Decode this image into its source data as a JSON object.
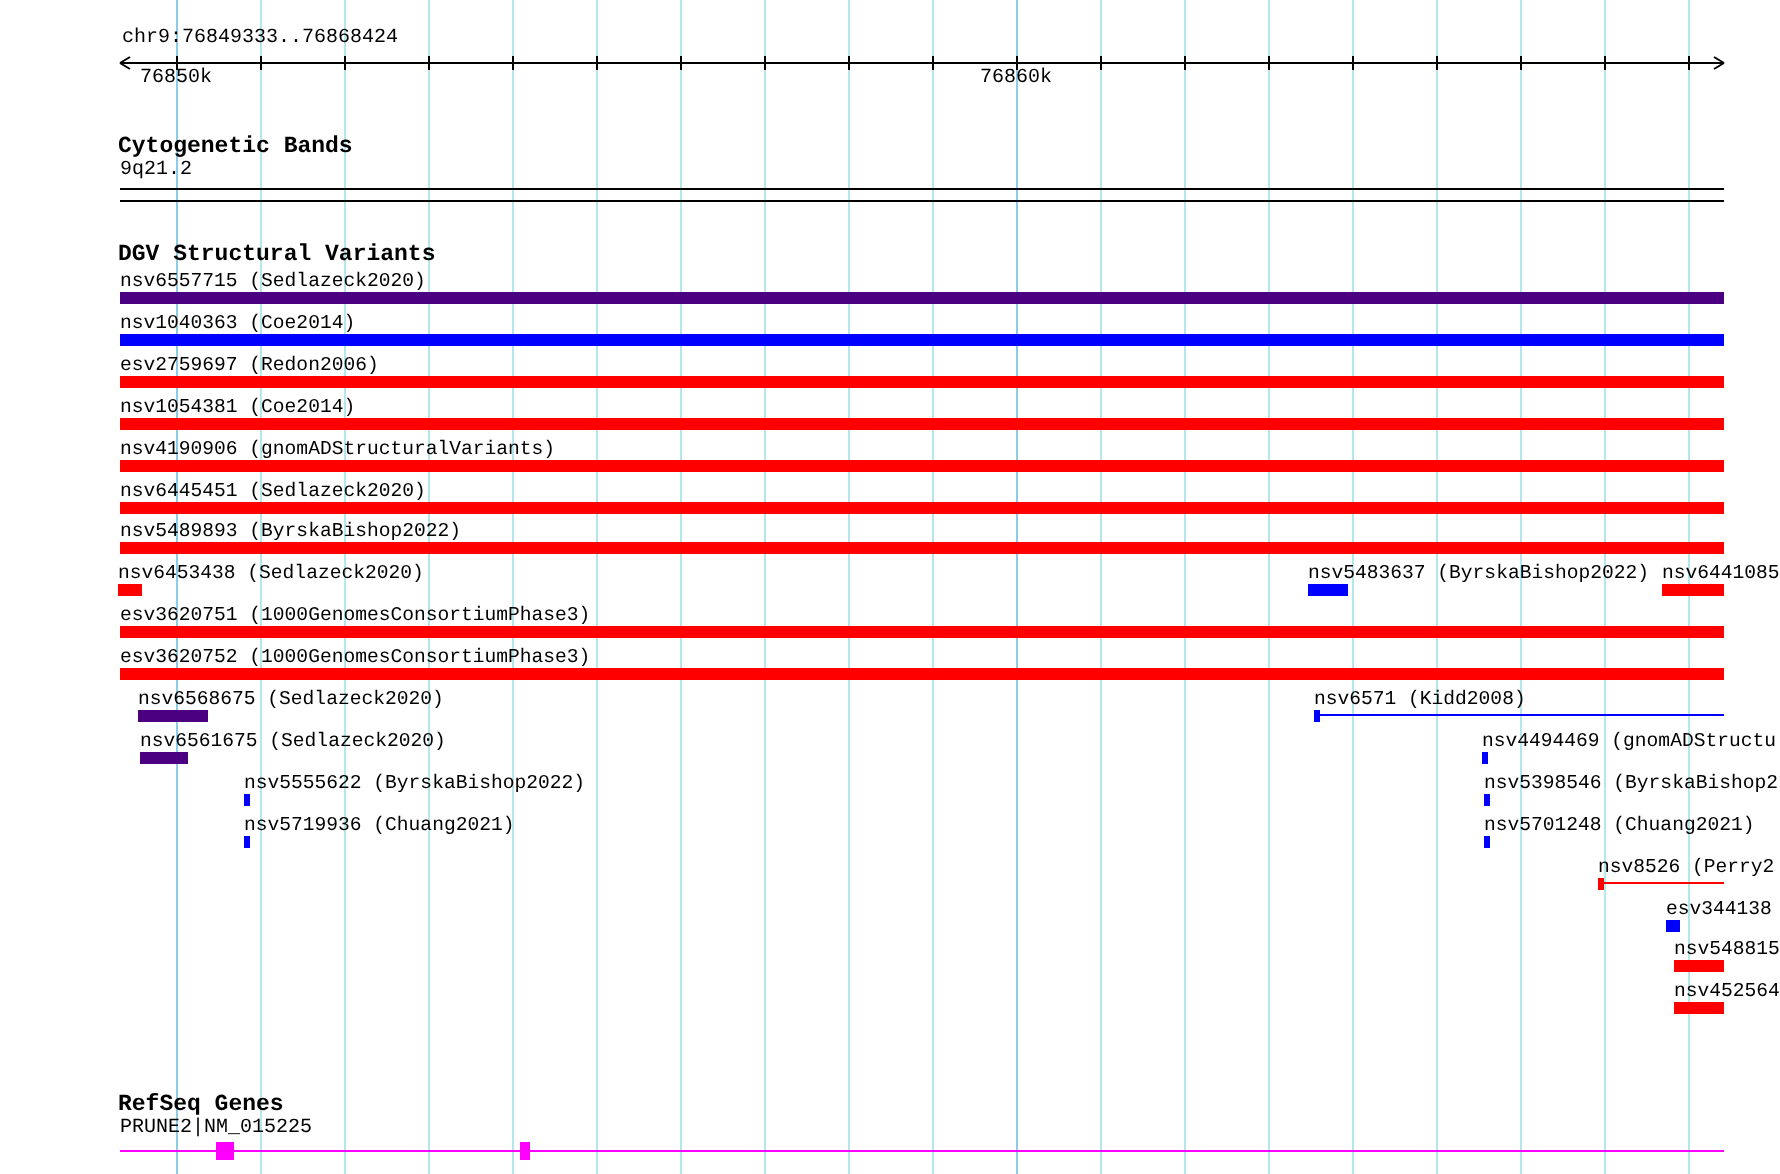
{
  "region": {
    "label": "chr9:76849333..76868424"
  },
  "ruler": {
    "ticks": [
      {
        "label": "76850k"
      },
      {
        "label": "76860k"
      }
    ]
  },
  "tracks": [
    {
      "kind": "bands",
      "title": "Cytogenetic Bands",
      "bands": [
        {
          "label": "9q21.2"
        }
      ]
    },
    {
      "kind": "variants",
      "title": "DGV Structural Variants",
      "rows": [
        [
          {
            "label": "nsv6557715 (Sedlazeck2020)",
            "color": "#4b0082",
            "kind": "block"
          }
        ],
        [
          {
            "label": "nsv1040363 (Coe2014)",
            "color": "#0000ff",
            "kind": "block"
          }
        ],
        [
          {
            "label": "esv2759697 (Redon2006)",
            "color": "#ff0000",
            "kind": "block"
          }
        ],
        [
          {
            "label": "nsv1054381 (Coe2014)",
            "color": "#ff0000",
            "kind": "block"
          }
        ],
        [
          {
            "label": "nsv4190906 (gnomADStructuralVariants)",
            "color": "#ff0000",
            "kind": "block"
          }
        ],
        [
          {
            "label": "nsv6445451 (Sedlazeck2020)",
            "color": "#ff0000",
            "kind": "block"
          }
        ],
        [
          {
            "label": "nsv5489893 (ByrskaBishop2022)",
            "color": "#ff0000",
            "kind": "block"
          }
        ],
        [
          {
            "label": "nsv6453438 (Sedlazeck2020)",
            "color": "#ff0000",
            "kind": "block"
          },
          {
            "label": "nsv5483637 (ByrskaBishop2022)",
            "color": "#0000ff",
            "kind": "block"
          },
          {
            "label": "nsv6441085",
            "color": "#ff0000",
            "kind": "block"
          }
        ],
        [
          {
            "label": "esv3620751 (1000GenomesConsortiumPhase3)",
            "color": "#ff0000",
            "kind": "block"
          }
        ],
        [
          {
            "label": "esv3620752 (1000GenomesConsortiumPhase3)",
            "color": "#ff0000",
            "kind": "block"
          }
        ],
        [
          {
            "label": "nsv6568675 (Sedlazeck2020)",
            "color": "#4b0082",
            "kind": "block"
          },
          {
            "label": "nsv6571 (Kidd2008)",
            "color": "#0000ff",
            "kind": "line"
          }
        ],
        [
          {
            "label": "nsv6561675 (Sedlazeck2020)",
            "color": "#4b0082",
            "kind": "block"
          },
          {
            "label": "nsv4494469 (gnomADStructu",
            "color": "#0000ff",
            "kind": "block"
          }
        ],
        [
          {
            "label": "nsv5555622 (ByrskaBishop2022)",
            "color": "#0000ff",
            "kind": "block"
          },
          {
            "label": "nsv5398546 (ByrskaBishop2",
            "color": "#0000ff",
            "kind": "block"
          }
        ],
        [
          {
            "label": "nsv5719936 (Chuang2021)",
            "color": "#0000ff",
            "kind": "block"
          },
          {
            "label": "nsv5701248 (Chuang2021)",
            "color": "#0000ff",
            "kind": "block"
          }
        ],
        [
          {
            "label": "nsv8526 (Perry2",
            "color": "#ff0000",
            "kind": "line"
          }
        ],
        [
          {
            "label": "esv344138",
            "color": "#0000ff",
            "kind": "block"
          }
        ],
        [
          {
            "label": "nsv548815",
            "color": "#ff0000",
            "kind": "block"
          }
        ],
        [
          {
            "label": "nsv452564",
            "color": "#ff0000",
            "kind": "block"
          }
        ]
      ]
    },
    {
      "kind": "genes",
      "title": "RefSeq Genes",
      "genes": [
        {
          "label": "PRUNE2|NM_015225"
        }
      ]
    }
  ]
}
